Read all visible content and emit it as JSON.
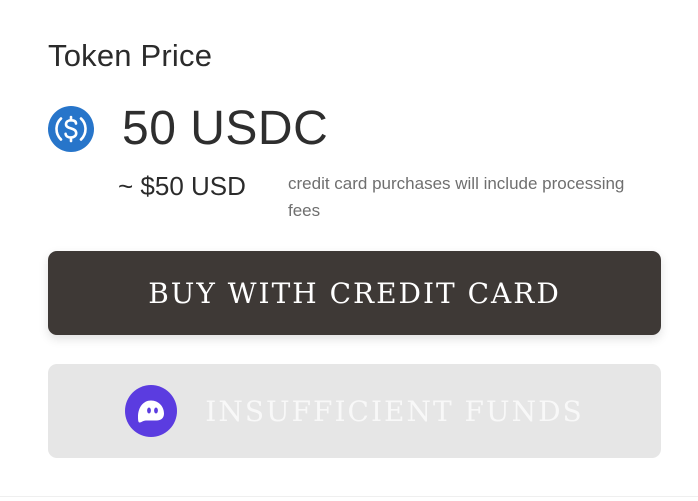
{
  "token_price": {
    "title": "Token Price",
    "amount": "50 USDC",
    "currency_icon": "usdc-icon",
    "usd_estimate": "~ $50 USD",
    "fee_note": "credit card purchases will include processing fees"
  },
  "actions": {
    "buy_label": "BUY WITH CREDIT CARD",
    "insufficient_label": "INSUFFICIENT FUNDS",
    "wallet_icon": "phantom-wallet-icon"
  },
  "colors": {
    "usdc_blue": "#2775CA",
    "buy_button_bg": "#3E3936",
    "disabled_button_bg": "#E6E6E6",
    "phantom_purple": "#5B3CE0"
  }
}
